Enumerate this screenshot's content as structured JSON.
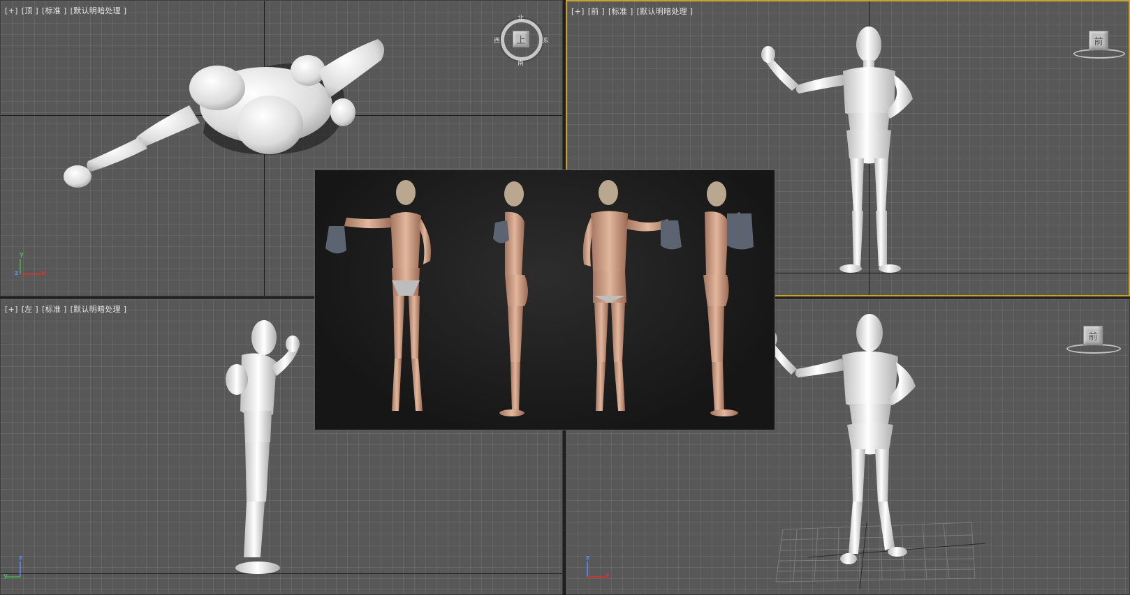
{
  "viewports": {
    "top": {
      "labels": [
        "[+]",
        "[顶 ]",
        "[标准 ]",
        "[默认明暗处理 ]"
      ],
      "navcube_face": "上",
      "compass": {
        "north": "北",
        "south": "南",
        "east": "东",
        "west": "西"
      },
      "axes": {
        "a": "y",
        "b": "x",
        "c": "z"
      }
    },
    "front": {
      "labels": [
        "[+]",
        "[前 ]",
        "[标准 ]",
        "[默认明暗处理 ]"
      ],
      "navcube_face": "前"
    },
    "left": {
      "labels": [
        "[+]",
        "[左 ]",
        "[标准 ]",
        "[默认明暗处理 ]"
      ],
      "axes": {
        "a": "z",
        "b": "y"
      }
    },
    "perspective": {
      "navcube_face": "前",
      "axes": {
        "a": "z",
        "b": "x"
      }
    }
  },
  "colors": {
    "viewport_bg": "#585858",
    "active_border": "#c9a227",
    "model": "#e9e9e9"
  },
  "reference_image": {
    "content": "four-view reference photo"
  }
}
